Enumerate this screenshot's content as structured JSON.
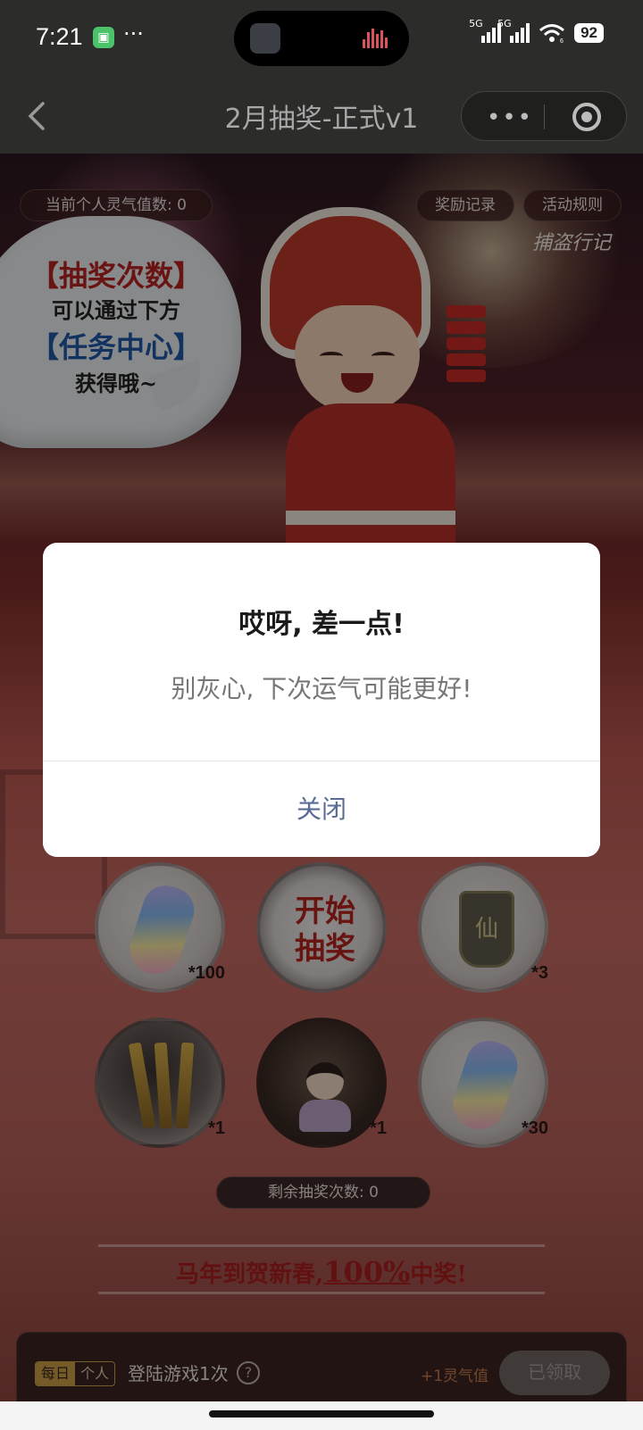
{
  "status_bar": {
    "time": "7:21",
    "signal_1_label": "5G",
    "signal_2_label": "5G",
    "wifi_label": "6",
    "battery": "92",
    "app_icon": "wechat-mini-icon",
    "accent_color": "#4cc36a"
  },
  "nav": {
    "title": "2月抽奖-正式v1",
    "back_icon": "chevron-left-icon",
    "more_icon": "more-dots-icon",
    "close_icon": "target-circle-icon"
  },
  "hero": {
    "aura_label": "当前个人灵气值数: 0",
    "record_button": "奖励记录",
    "rules_button": "活动规则",
    "game_logo": "捕盗行记",
    "bubble_line1": "【抽奖次数】",
    "bubble_line2": "可以通过下方",
    "bubble_line3": "【任务中心】",
    "bubble_line4": "获得哦~"
  },
  "prizes": [
    {
      "icon": "crystal-icon",
      "count": "*100"
    },
    {
      "label": "开始\n抽奖",
      "icon": "start-draw-icon"
    },
    {
      "icon": "amulet-icon",
      "count": "*3",
      "glyph": "仙"
    },
    {
      "icon": "swords-icon",
      "count": "*1"
    },
    {
      "icon": "character-portrait-icon",
      "count": "*1"
    },
    {
      "icon": "crystal-icon",
      "count": "*30"
    }
  ],
  "start_label_line1": "开始",
  "start_label_line2": "抽奖",
  "remaining_label": "剩余抽奖次数: 0",
  "banner": {
    "prefix": "马年到贺新春,",
    "highlight": "100%",
    "suffix": "中奖!"
  },
  "task": {
    "tag_daily": "每日",
    "tag_personal": "个人",
    "name": "登陆游戏1次",
    "help_icon": "question-circle-icon",
    "reward": "+1灵气值",
    "button": "已领取"
  },
  "dialog": {
    "title": "哎呀, 差一点!",
    "message": "别灰心, 下次运气可能更好!",
    "close_button": "关闭",
    "close_color": "#5a6c94"
  }
}
